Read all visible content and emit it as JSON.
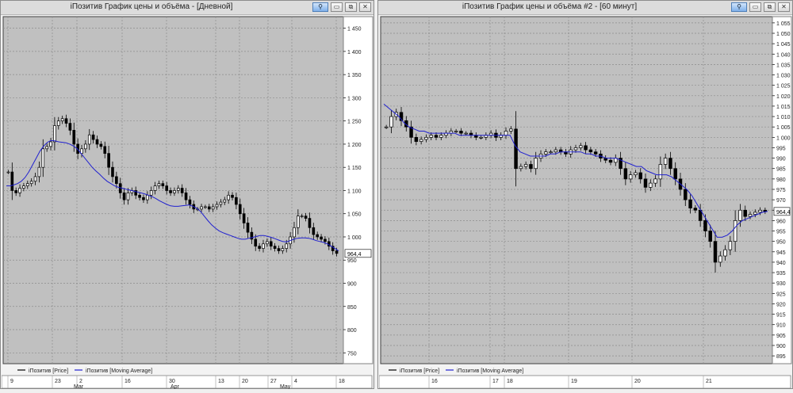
{
  "windows": [
    {
      "title": "iПозитив График цены и объёма - [Дневной]",
      "buttons": {
        "pin": "⚲",
        "minimize": "▭",
        "maximize": "⧉",
        "close": "✕"
      },
      "last_price_label": "964,4",
      "legend": [
        {
          "label": "iПозитив [Price]",
          "color": "#000000"
        },
        {
          "label": "iПозитив [Moving Average]",
          "color": "#2020d0"
        }
      ],
      "date_row1": [
        "9",
        "23",
        "2",
        "16",
        "30",
        "13",
        "20",
        "27",
        "4",
        "18"
      ],
      "date_row2": [
        "Mar",
        "Apr",
        "May"
      ]
    },
    {
      "title": "iПозитив График цены и объёма #2 - [60 минут]",
      "buttons": {
        "pin": "⚲",
        "minimize": "▭",
        "maximize": "⧉",
        "close": "✕"
      },
      "last_price_label": "964,4",
      "legend": [
        {
          "label": "iПозитив [Price]",
          "color": "#000000"
        },
        {
          "label": "iПозитив [Moving Average]",
          "color": "#2020d0"
        }
      ],
      "date_row1": [
        "16",
        "17",
        "18",
        "19",
        "20",
        "21"
      ],
      "date_row2": []
    }
  ],
  "chart_data": [
    {
      "type": "line",
      "title": "iПозитив График цены и объёма - [Дневной]",
      "y_ticks": [
        1450,
        1400,
        1350,
        1300,
        1250,
        1200,
        1150,
        1100,
        1050,
        1000,
        950,
        900,
        850,
        800,
        750
      ],
      "ylim": [
        730,
        1475
      ],
      "grid": true,
      "legend_position": "bottom-left",
      "x_tick_labels": [
        "9",
        "23",
        "2",
        "16",
        "30",
        "13",
        "20",
        "27",
        "4",
        "18"
      ],
      "x_month_labels": [
        "Mar",
        "Apr",
        "May"
      ],
      "last_value": 964.4,
      "series": [
        {
          "name": "iПозитив [Price]",
          "values": [
            1140,
            1100,
            1095,
            1105,
            1110,
            1115,
            1120,
            1130,
            1150,
            1190,
            1195,
            1205,
            1240,
            1250,
            1255,
            1245,
            1230,
            1200,
            1180,
            1190,
            1200,
            1220,
            1210,
            1200,
            1195,
            1180,
            1150,
            1130,
            1115,
            1095,
            1080,
            1095,
            1100,
            1090,
            1085,
            1080,
            1090,
            1100,
            1110,
            1115,
            1110,
            1100,
            1095,
            1100,
            1105,
            1095,
            1080,
            1070,
            1060,
            1060,
            1065,
            1065,
            1060,
            1065,
            1070,
            1075,
            1080,
            1090,
            1085,
            1070,
            1050,
            1030,
            1010,
            995,
            980,
            975,
            985,
            990,
            980,
            975,
            970,
            975,
            985,
            1000,
            1020,
            1045,
            1045,
            1040,
            1020,
            1005,
            1000,
            995,
            990,
            980,
            970,
            964.4
          ]
        },
        {
          "name": "iПозитив [Moving Average]",
          "values": [
            1110,
            1110,
            1112,
            1115,
            1120,
            1128,
            1140,
            1155,
            1170,
            1185,
            1196,
            1204,
            1208,
            1207,
            1205,
            1204,
            1203,
            1200,
            1196,
            1190,
            1180,
            1170,
            1160,
            1150,
            1142,
            1135,
            1127,
            1120,
            1115,
            1110,
            1107,
            1105,
            1103,
            1101,
            1099,
            1097,
            1095,
            1093,
            1090,
            1087,
            1083,
            1078,
            1074,
            1070,
            1067,
            1066,
            1066,
            1067,
            1068,
            1069,
            1066,
            1062,
            1055,
            1045,
            1035,
            1026,
            1019,
            1013,
            1009,
            1006,
            1003,
            1000,
            997,
            995,
            995,
            997,
            999,
            1001,
            1003,
            1003,
            1001,
            999,
            996,
            993,
            990,
            989,
            992,
            995,
            997,
            998,
            998,
            997,
            995,
            992,
            990,
            988,
            985,
            980,
            975,
            970
          ]
        }
      ]
    },
    {
      "type": "line",
      "title": "iПозитив График цены и объёма #2 - [60 минут]",
      "y_ticks": [
        1055,
        1050,
        1045,
        1040,
        1035,
        1030,
        1025,
        1020,
        1015,
        1010,
        1005,
        1000,
        995,
        990,
        985,
        980,
        975,
        970,
        965,
        960,
        955,
        950,
        945,
        940,
        935,
        930,
        925,
        920,
        915,
        910,
        905,
        900,
        895
      ],
      "ylim": [
        892,
        1058
      ],
      "grid": true,
      "legend_position": "bottom-left",
      "x_tick_labels": [
        "16",
        "17",
        "18",
        "19",
        "20",
        "21"
      ],
      "last_value": 964.4,
      "series": [
        {
          "name": "iПозитив [Price]",
          "values": [
            1005,
            1010,
            1012,
            1008,
            1005,
            1000,
            998,
            999,
            1000,
            1001,
            1000,
            1001,
            1002,
            1003,
            1003,
            1002,
            1002,
            1001,
            1000,
            1000,
            1001,
            1002,
            1000,
            1001,
            1003,
            1004,
            985,
            986,
            987,
            985,
            990,
            992,
            993,
            993,
            994,
            993,
            992,
            994,
            995,
            996,
            994,
            993,
            992,
            990,
            989,
            988,
            990,
            985,
            980,
            982,
            983,
            980,
            976,
            978,
            980,
            987,
            990,
            985,
            980,
            975,
            970,
            966,
            965,
            960,
            955,
            950,
            940,
            943,
            946,
            950,
            960,
            965,
            962,
            963,
            964,
            965,
            964.4
          ]
        },
        {
          "name": "iПозитив [Moving Average]",
          "values": [
            1016,
            1014,
            1012,
            1010,
            1007,
            1005,
            1004,
            1003,
            1003,
            1002,
            1002,
            1002,
            1002,
            1002,
            1002,
            1001,
            1001,
            1001,
            1001,
            1001,
            1001,
            1001,
            1001,
            1001,
            1001,
            1001,
            996,
            993,
            992,
            991,
            991,
            991,
            991,
            992,
            992,
            993,
            993,
            993,
            993,
            993,
            992,
            992,
            991,
            991,
            990,
            990,
            990,
            989,
            988,
            987,
            986,
            986,
            984,
            983,
            982,
            982,
            982,
            981,
            979,
            977,
            975,
            972,
            968,
            964,
            960,
            956,
            952,
            952,
            953,
            955,
            958,
            960,
            961,
            962,
            963,
            964,
            964.4
          ]
        }
      ]
    }
  ]
}
